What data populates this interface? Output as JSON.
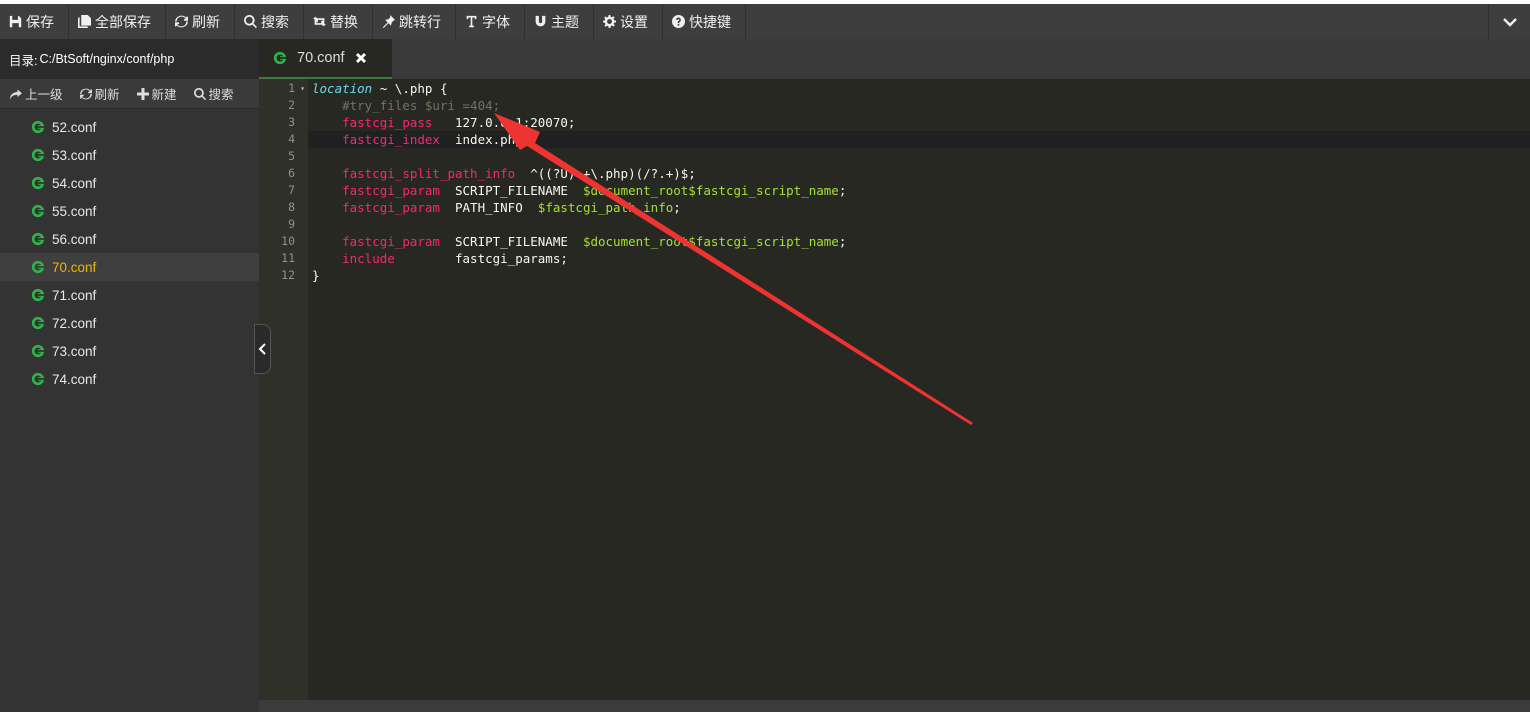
{
  "toolbar": {
    "items": [
      {
        "label": "保存",
        "icon": "save-icon"
      },
      {
        "label": "全部保存",
        "icon": "save-all-icon"
      },
      {
        "label": "刷新",
        "icon": "refresh-icon"
      },
      {
        "label": "搜索",
        "icon": "search-icon"
      },
      {
        "label": "替换",
        "icon": "replace-icon"
      },
      {
        "label": "跳转行",
        "icon": "pin-icon"
      },
      {
        "label": "字体",
        "icon": "font-icon"
      },
      {
        "label": "主题",
        "icon": "magnet-icon"
      },
      {
        "label": "设置",
        "icon": "gear-icon"
      },
      {
        "label": "快捷键",
        "icon": "help-icon"
      }
    ],
    "collapse_icon": "chevron-down-icon"
  },
  "sidebar": {
    "dir_prefix": "目录:",
    "dir_path": "C:/BtSoft/nginx/conf/php",
    "actions": [
      {
        "label": "上一级",
        "icon": "up-level-icon"
      },
      {
        "label": "刷新",
        "icon": "refresh-icon"
      },
      {
        "label": "新建",
        "icon": "plus-icon"
      },
      {
        "label": "搜索",
        "icon": "search-icon"
      }
    ],
    "files": [
      "52.conf",
      "53.conf",
      "54.conf",
      "55.conf",
      "56.conf",
      "70.conf",
      "71.conf",
      "72.conf",
      "73.conf",
      "74.conf"
    ],
    "active_file": "70.conf"
  },
  "tab": {
    "label": "70.conf",
    "close_icon": "close-icon"
  },
  "editor": {
    "line_numbers": [
      "1",
      "2",
      "3",
      "4",
      "5",
      "6",
      "7",
      "8",
      "9",
      "10",
      "11",
      "12"
    ],
    "lines": [
      [
        {
          "t": "location",
          "c": "kw"
        },
        {
          "t": " ~ \\.php {",
          "c": ""
        }
      ],
      [
        {
          "t": "    #try_files $uri =404;",
          "c": "cmt"
        }
      ],
      [
        {
          "t": "    ",
          "c": ""
        },
        {
          "t": "fastcgi_pass",
          "c": "dir"
        },
        {
          "t": "   127.0.0.1:20070;",
          "c": ""
        }
      ],
      [
        {
          "t": "    ",
          "c": ""
        },
        {
          "t": "fastcgi_index",
          "c": "dir"
        },
        {
          "t": "  index.php;",
          "c": ""
        }
      ],
      [
        {
          "t": "",
          "c": ""
        }
      ],
      [
        {
          "t": "    ",
          "c": ""
        },
        {
          "t": "fastcgi_split_path_info",
          "c": "dir"
        },
        {
          "t": "  ^((?U).+\\.php)(/?.+)$;",
          "c": ""
        }
      ],
      [
        {
          "t": "    ",
          "c": ""
        },
        {
          "t": "fastcgi_param",
          "c": "dir"
        },
        {
          "t": "  SCRIPT_FILENAME  ",
          "c": ""
        },
        {
          "t": "$document_root$fastcgi_script_name",
          "c": "var"
        },
        {
          "t": ";",
          "c": ""
        }
      ],
      [
        {
          "t": "    ",
          "c": ""
        },
        {
          "t": "fastcgi_param",
          "c": "dir"
        },
        {
          "t": "  PATH_INFO  ",
          "c": ""
        },
        {
          "t": "$fastcgi_path_info",
          "c": "var"
        },
        {
          "t": ";",
          "c": ""
        }
      ],
      [
        {
          "t": "",
          "c": ""
        }
      ],
      [
        {
          "t": "    ",
          "c": ""
        },
        {
          "t": "fastcgi_param",
          "c": "dir"
        },
        {
          "t": "  SCRIPT_FILENAME  ",
          "c": ""
        },
        {
          "t": "$document_root$fastcgi_script_name",
          "c": "var"
        },
        {
          "t": ";",
          "c": ""
        }
      ],
      [
        {
          "t": "    ",
          "c": ""
        },
        {
          "t": "include",
          "c": "dir"
        },
        {
          "t": "        fastcgi_params;",
          "c": ""
        }
      ],
      [
        {
          "t": "}",
          "c": ""
        }
      ]
    ],
    "current_line": 4
  },
  "annotation": {
    "color": "#ee3333"
  }
}
